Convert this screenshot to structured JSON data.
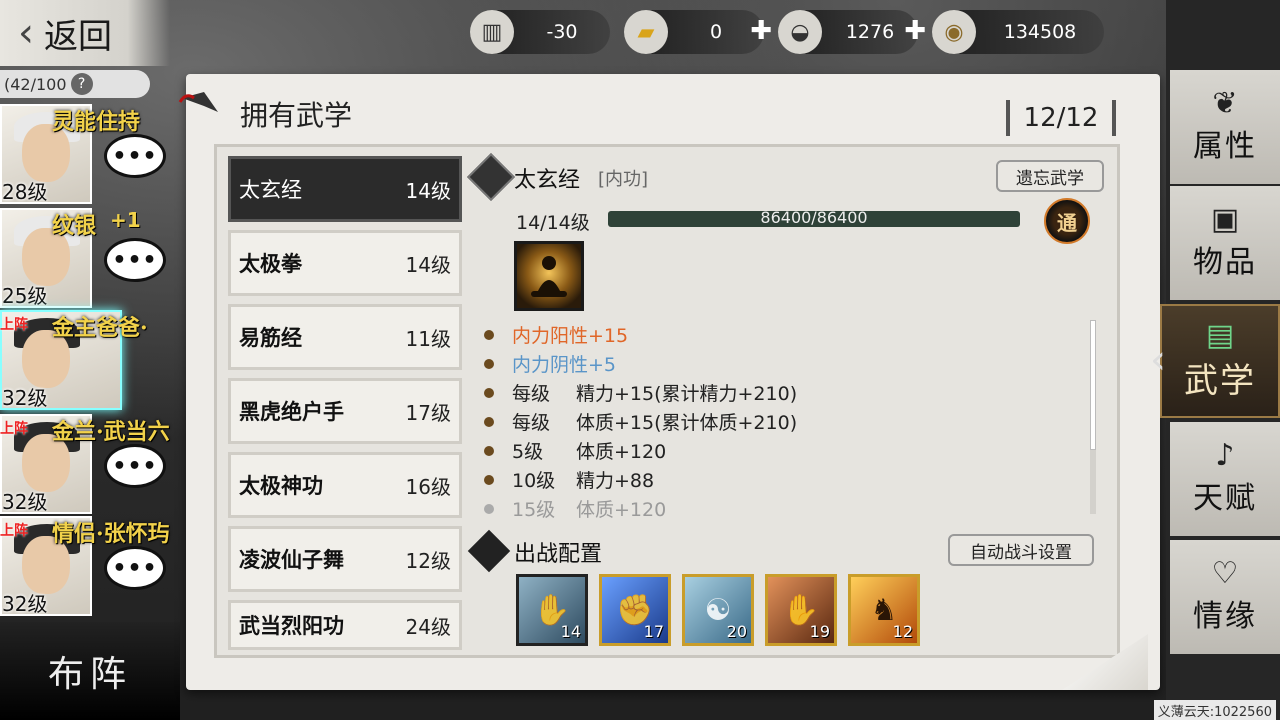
{
  "nav": {
    "back_label": "返回",
    "back_icon": "chevron-left-icon"
  },
  "resources": [
    {
      "icon": "table-icon",
      "value": "-30",
      "has_plus": false
    },
    {
      "icon": "gold-bar-icon",
      "value": "0",
      "has_plus": true
    },
    {
      "icon": "silver-ingot-icon",
      "value": "1276",
      "has_plus": true
    },
    {
      "icon": "coin-icon",
      "value": "134508",
      "has_plus": false
    }
  ],
  "party": {
    "count": "(42/100",
    "help": "?",
    "members": [
      {
        "name": "灵能住持",
        "level": "28级",
        "tag": "",
        "extra": "",
        "bubble": "•••"
      },
      {
        "name": "纹银",
        "level": "25级",
        "tag": "",
        "extra": "+1",
        "bubble": "•••"
      },
      {
        "name": "金主爸爸·",
        "level": "32级",
        "tag": "上阵",
        "extra": "",
        "bubble": ""
      },
      {
        "name": "金兰·武当六",
        "level": "32级",
        "tag": "上阵",
        "extra": "",
        "bubble": "•••"
      },
      {
        "name": "情侣·张怀玙",
        "level": "32级",
        "tag": "上阵",
        "extra": "",
        "bubble": "•••"
      }
    ],
    "formation_label": "布阵"
  },
  "panel": {
    "title": "拥有武学",
    "count": "12/12"
  },
  "skills": [
    {
      "name": "太玄经",
      "level": "14级",
      "selected": true
    },
    {
      "name": "太极拳",
      "level": "14级",
      "selected": false
    },
    {
      "name": "易筋经",
      "level": "11级",
      "selected": false
    },
    {
      "name": "黑虎绝户手",
      "level": "17级",
      "selected": false
    },
    {
      "name": "太极神功",
      "level": "16级",
      "selected": false
    },
    {
      "name": "凌波仙子舞",
      "level": "12级",
      "selected": false
    },
    {
      "name": "武当烈阳功",
      "level": "24级",
      "selected": false
    }
  ],
  "detail": {
    "name": "太玄经",
    "type": "[内功]",
    "forget_label": "遗忘武学",
    "level_text": "14/14级",
    "progress_text": "86400/86400",
    "progress_fraction": 1.0,
    "badge": "通",
    "effects": [
      {
        "c1": "内力阳性+15",
        "c2": "",
        "style": "orange"
      },
      {
        "c1": "内力阴性+5",
        "c2": "",
        "style": "blue"
      },
      {
        "c1": "每级",
        "c2": "精力+15(累计精力+210)",
        "style": "normal"
      },
      {
        "c1": "每级",
        "c2": "体质+15(累计体质+210)",
        "style": "normal"
      },
      {
        "c1": "5级",
        "c2": "体质+120",
        "style": "normal"
      },
      {
        "c1": "10级",
        "c2": "精力+88",
        "style": "normal"
      },
      {
        "c1": "15级",
        "c2": "体质+120",
        "style": "dim"
      }
    ],
    "battle_title": "出战配置",
    "auto_label": "自动战斗设置",
    "moves": [
      {
        "level": "14",
        "color": "#4a6a80",
        "gold": false
      },
      {
        "level": "17",
        "color": "#2a58b8",
        "gold": true
      },
      {
        "level": "20",
        "color": "#5a8aa8",
        "gold": true
      },
      {
        "level": "19",
        "color": "#b35a24",
        "gold": true
      },
      {
        "level": "12",
        "color": "#d77a18",
        "gold": true
      }
    ]
  },
  "side_tabs": [
    {
      "label": "属性",
      "icon": "rat-icon",
      "selected": false
    },
    {
      "label": "物品",
      "icon": "box-icon",
      "selected": false
    },
    {
      "label": "武学",
      "icon": "book-icon",
      "selected": true
    },
    {
      "label": "天赋",
      "icon": "note-icon",
      "selected": false
    },
    {
      "label": "情缘",
      "icon": "heart-icon",
      "selected": false
    }
  ],
  "watermark": "义薄云天:1022560"
}
